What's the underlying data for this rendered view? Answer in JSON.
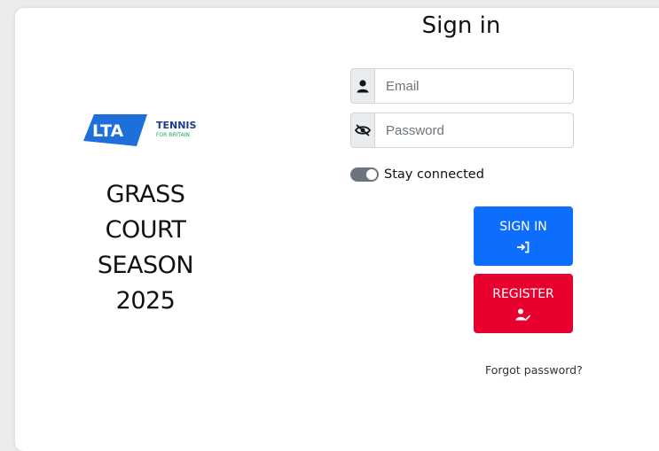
{
  "brand": {
    "logo_text": "LTA",
    "logo_tag_line1": "TENNIS",
    "logo_tag_line2": "FOR BRITAIN",
    "primary_color": "#1e6fd9",
    "accent_color": "#14a86b"
  },
  "season": {
    "lines": [
      "GRASS",
      "COURT",
      "SEASON",
      "2025"
    ]
  },
  "signin": {
    "title": "Sign in",
    "email": {
      "icon": "user-icon",
      "placeholder": "Email",
      "value": ""
    },
    "password": {
      "icon": "eye-slash-icon",
      "placeholder": "Password",
      "value": ""
    },
    "stay_connected": {
      "label": "Stay connected",
      "checked": true
    },
    "signin_button": {
      "label": "SIGN IN",
      "icon": "sign-in-icon",
      "color": "#0d6efd"
    },
    "register_button": {
      "label": "REGISTER",
      "icon": "user-edit-icon",
      "color": "#e8002e"
    },
    "forgot_password": "Forgot password?"
  }
}
